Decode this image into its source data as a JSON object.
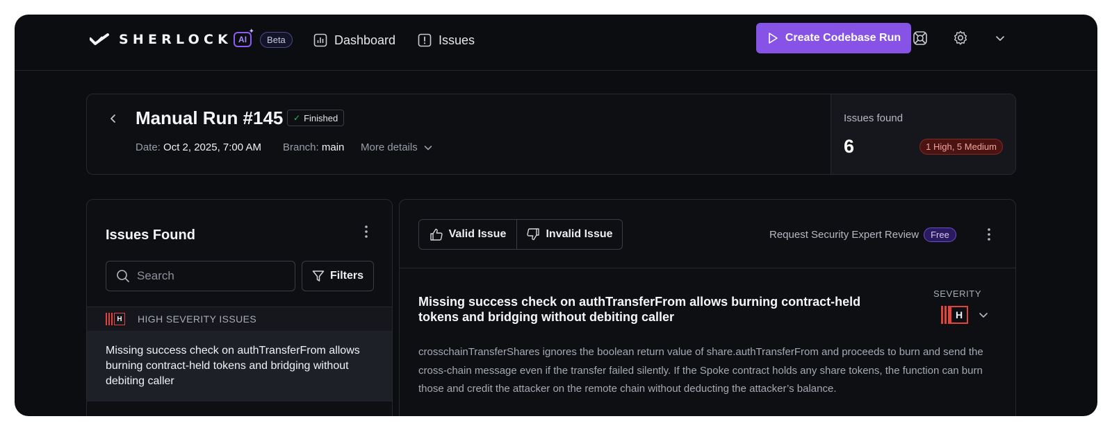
{
  "app": {
    "brand": "SHERLOCK",
    "ai_label": "AI",
    "beta_label": "Beta"
  },
  "nav": {
    "dashboard": "Dashboard",
    "issues": "Issues",
    "create_run": "Create Codebase Run"
  },
  "run": {
    "title": "Manual Run #145",
    "status": "Finished",
    "date_label": "Date:",
    "date_value": "Oct 2, 2025, 7:00 AM",
    "branch_label": "Branch:",
    "branch_value": "main",
    "more_details": "More details",
    "issues_found_label": "Issues found",
    "issues_found_count": "6",
    "severity_summary": "1 High, 5 Medium"
  },
  "issues_panel": {
    "title": "Issues Found",
    "search_placeholder": "Search",
    "filters_label": "Filters",
    "groups": [
      {
        "severity_letter": "H",
        "label": "HIGH SEVERITY ISSUES",
        "items": [
          {
            "title": "Missing success check on authTransferFrom allows burning contract-held tokens and bridging without debiting caller"
          }
        ]
      }
    ]
  },
  "detail": {
    "valid_label": "Valid Issue",
    "invalid_label": "Invalid Issue",
    "expert_review_label": "Request Security Expert Review",
    "free_label": "Free",
    "title": "Missing success check on authTransferFrom allows burning contract-held tokens and bridging without debiting caller",
    "severity_heading": "SEVERITY",
    "severity_letter": "H",
    "description": "crosschainTransferShares ignores the boolean return value of share.authTransferFrom and proceeds to burn and send the cross-chain message even if the transfer failed silently. If the Spoke contract holds any share tokens, the function can burn those and credit the attacker on the remote chain without deducting the attacker’s balance."
  },
  "colors": {
    "accent": "#8653e6",
    "high_severity": "#e2443b",
    "success": "#22c55e",
    "background": "#0b0d11"
  },
  "icons": {
    "logo": "sherlock-logo-icon",
    "dashboard": "bar-chart-icon",
    "issues": "alert-square-icon",
    "create_run": "play-icon",
    "support": "lifebuoy-icon",
    "settings": "gear-icon",
    "account_menu": "chevron-down-icon",
    "back": "chevron-left-icon",
    "search": "search-icon",
    "filters": "funnel-icon",
    "valid": "thumbs-up-icon",
    "invalid": "thumbs-down-icon",
    "more": "kebab-icon"
  }
}
